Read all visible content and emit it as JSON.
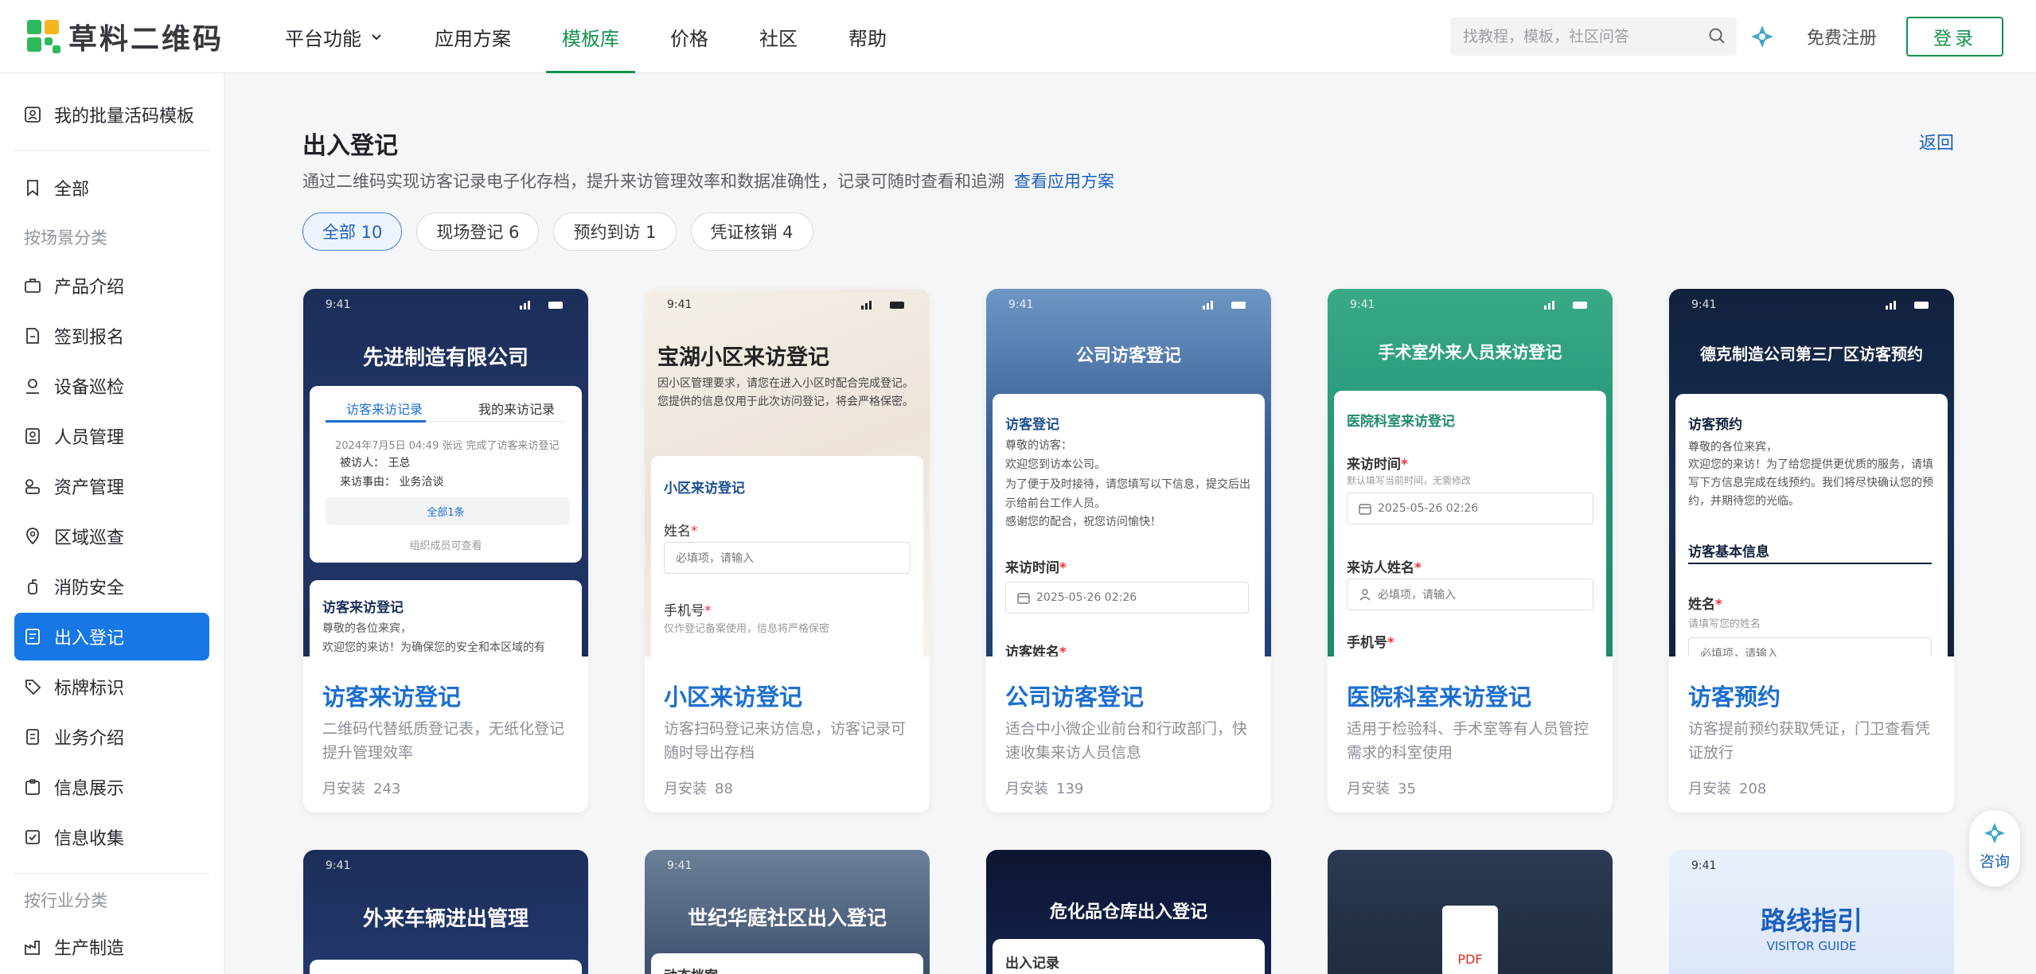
{
  "header": {
    "logo_text": "草料二维码",
    "nav": [
      {
        "label": "平台功能",
        "has_dropdown": true
      },
      {
        "label": "应用方案"
      },
      {
        "label": "模板库",
        "active": true
      },
      {
        "label": "价格"
      },
      {
        "label": "社区"
      },
      {
        "label": "帮助"
      }
    ],
    "search_placeholder": "找教程，模板，社区问答",
    "register_label": "免费注册",
    "login_label": "登录"
  },
  "sidebar": {
    "top_item": "我的批量活码模板",
    "all_item": "全部",
    "scene_group": "按场景分类",
    "scene_items": [
      "产品介绍",
      "签到报名",
      "设备巡检",
      "人员管理",
      "资产管理",
      "区域巡查",
      "消防安全",
      "出入登记",
      "标牌标识",
      "业务介绍",
      "信息展示",
      "信息收集"
    ],
    "active_item": "出入登记",
    "industry_group": "按行业分类",
    "industry_items": [
      "生产制造"
    ]
  },
  "main": {
    "title": "出入登记",
    "back_label": "返回",
    "description": "通过二维码实现访客记录电子化存档，提升来访管理效率和数据准确性，记录可随时查看和追溯",
    "solution_link": "查看应用方案",
    "filters": [
      {
        "label": "全部 10",
        "active": true
      },
      {
        "label": "现场登记 6"
      },
      {
        "label": "预约到访 1"
      },
      {
        "label": "凭证核销 4"
      }
    ],
    "installs_label": "月安装"
  },
  "cards": [
    {
      "name": "访客来访登记",
      "desc": "二维码代替纸质登记表，无纸化登记提升管理效率",
      "installs": "243",
      "preview": {
        "time": "9:41",
        "title": "先进制造有限公司",
        "tabs": [
          "访客来访记录",
          "我的来访记录"
        ],
        "log_line": "2024年7月5日 04:49 张远 完成了访客来访登记",
        "visitor_label": "被访人：",
        "visitor": "王总",
        "reason_label": "来访事由：",
        "reason": "业务洽谈",
        "all_count": "全部1条",
        "org_view": "组织成员可查看",
        "section_title": "访客来访登记",
        "greeting": "尊敬的各位来宾，",
        "intro": "欢迎您的来访！为确保您的安全和本区域的有"
      }
    },
    {
      "name": "小区来访登记",
      "desc": "访客扫码登记来访信息，访客记录可随时导出存档",
      "installs": "88",
      "preview": {
        "time": "9:41",
        "title": "宝湖小区来访登记",
        "intro": "因小区管理要求，请您在进入小区时配合完成登记。您提供的信息仅用于此次访问登记，将会严格保密。",
        "section": "小区来访登记",
        "name_label": "姓名",
        "name_placeholder": "必填项，请输入",
        "phone_label": "手机号",
        "phone_hint": "仅作登记备案使用，信息将严格保密"
      }
    },
    {
      "name": "公司访客登记",
      "desc": "适合中小微企业前台和行政部门，快速收集来访人员信息",
      "installs": "139",
      "preview": {
        "time": "9:41",
        "title": "公司访客登记",
        "section": "访客登记",
        "greeting": "尊敬的访客：",
        "l1": "欢迎您到访本公司。",
        "l2": "为了便于及时接待，请您填写以下信息，提交后出示给前台工作人员。",
        "l3": "感谢您的配合，祝您访问愉快！",
        "time_label": "来访时间",
        "time_value": "2025-05-26 02:26",
        "name_label": "访客姓名"
      }
    },
    {
      "name": "医院科室来访登记",
      "desc": "适用于检验科、手术室等有人员管控需求的科室使用",
      "installs": "35",
      "preview": {
        "time": "9:41",
        "title": "手术室外来人员来访登记",
        "section": "医院科室来访登记",
        "time_label": "来访时间",
        "time_hint": "默认填写当前时间，无需修改",
        "time_value": "2025-05-26 02:26",
        "name_label": "来访人姓名",
        "name_placeholder": "必填项，请输入",
        "phone_label": "手机号"
      }
    },
    {
      "name": "访客预约",
      "desc": "访客提前预约获取凭证，门卫查看凭证放行",
      "installs": "208",
      "preview": {
        "time": "9:41",
        "title": "德克制造公司第三厂区访客预约",
        "section": "访客预约",
        "greeting": "尊敬的各位来宾，",
        "intro": "欢迎您的来访！为了给您提供更优质的服务，请填写下方信息完成在线预约。我们将尽快确认您的预约，并期待您的光临。",
        "basic_info": "访客基本信息",
        "name_label": "姓名",
        "name_hint": "请填写您的姓名",
        "name_placeholder": "必填项，请输入"
      }
    }
  ],
  "bottom_cards": [
    {
      "time": "9:41",
      "title": "外来车辆进出管理"
    },
    {
      "time": "9:41",
      "title": "世纪华庭社区出入登记",
      "sub": "动态档案"
    },
    {
      "title": "危化品仓库出入登记",
      "sub": "出入记录"
    },
    {
      "badge": "PDF"
    },
    {
      "time": "9:41",
      "title": "路线指引",
      "sub": "VISITOR GUIDE"
    }
  ],
  "consult_label": "咨询"
}
